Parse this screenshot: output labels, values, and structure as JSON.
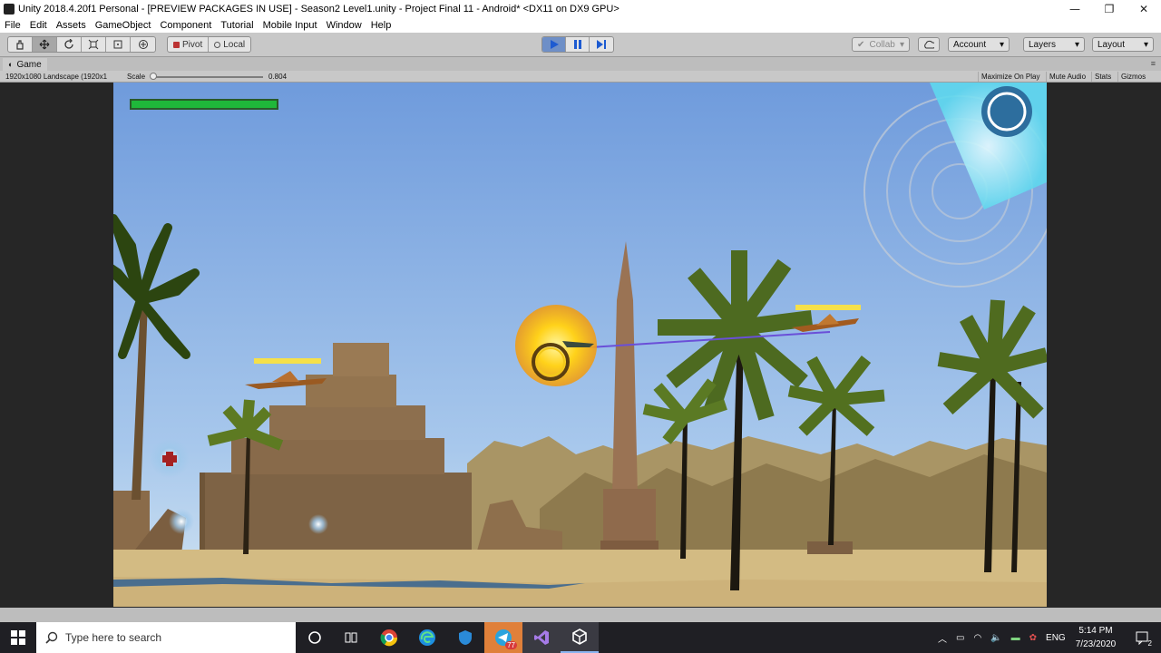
{
  "window": {
    "title": "Unity 2018.4.20f1 Personal - [PREVIEW PACKAGES IN USE] - Season2 Level1.unity - Project Final 11 - Android* <DX11 on DX9 GPU>",
    "minimize": "—",
    "maximize": "❐",
    "close": "✕"
  },
  "menu": {
    "items": [
      "File",
      "Edit",
      "Assets",
      "GameObject",
      "Component",
      "Tutorial",
      "Mobile Input",
      "Window",
      "Help"
    ]
  },
  "toolbar": {
    "pivot_label": "Pivot",
    "local_label": "Local",
    "collab_label": "Collab",
    "account_label": "Account",
    "layers_label": "Layers",
    "layout_label": "Layout",
    "play_active": true
  },
  "game_tab": {
    "label": "Game",
    "resolution": "1920x1080 Landscape (1920x1",
    "scale_label": "Scale",
    "scale_value": "0.804",
    "options": [
      "Maximize On Play",
      "Mute Audio",
      "Stats",
      "Gizmos"
    ]
  },
  "hud": {
    "player_health_fraction": 1.0,
    "health_color": "#1fb83a",
    "enemy_health_color": "#f5e04a"
  },
  "taskbar": {
    "search_placeholder": "Type here to search",
    "telegram_badge": "77",
    "language": "ENG",
    "time": "5:14 PM",
    "date": "7/23/2020",
    "notification_count": "2"
  },
  "colors": {
    "sky_top": "#7aa2df",
    "sky_bottom": "#c3dbef",
    "sand": "#d9c28a"
  }
}
